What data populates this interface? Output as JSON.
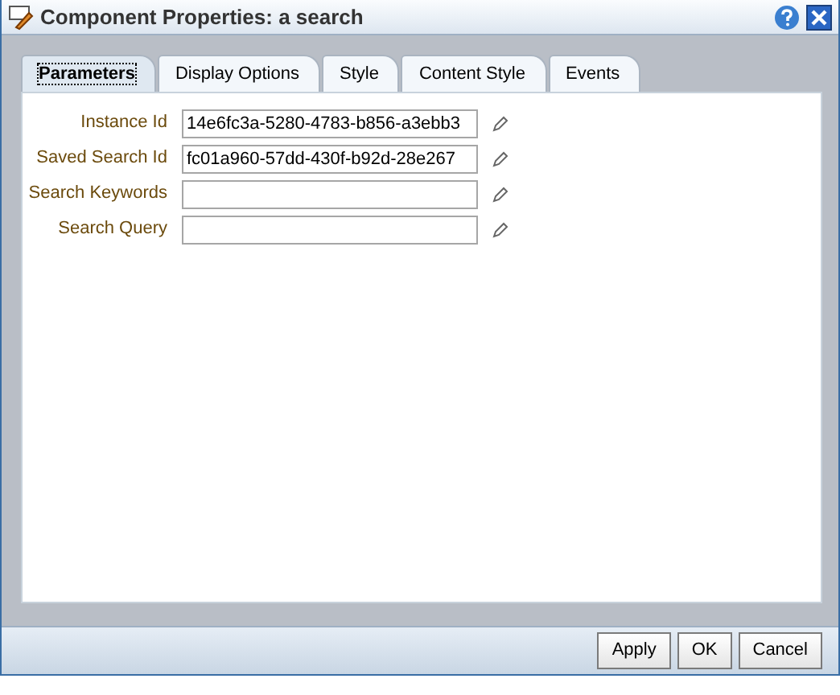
{
  "window": {
    "title": "Component Properties: a search"
  },
  "tabs": [
    {
      "label": "Parameters",
      "selected": true
    },
    {
      "label": "Display Options",
      "selected": false
    },
    {
      "label": "Style",
      "selected": false
    },
    {
      "label": "Content Style",
      "selected": false
    },
    {
      "label": "Events",
      "selected": false
    }
  ],
  "fields": [
    {
      "label": "Instance Id",
      "value": "14e6fc3a-5280-4783-b856-a3ebb3"
    },
    {
      "label": "Saved Search Id",
      "value": "fc01a960-57dd-430f-b92d-28e267"
    },
    {
      "label": "Search Keywords"
    },
    {
      "label": "Search Query"
    }
  ],
  "buttons": [
    "Apply",
    "OK",
    "Cancel"
  ]
}
